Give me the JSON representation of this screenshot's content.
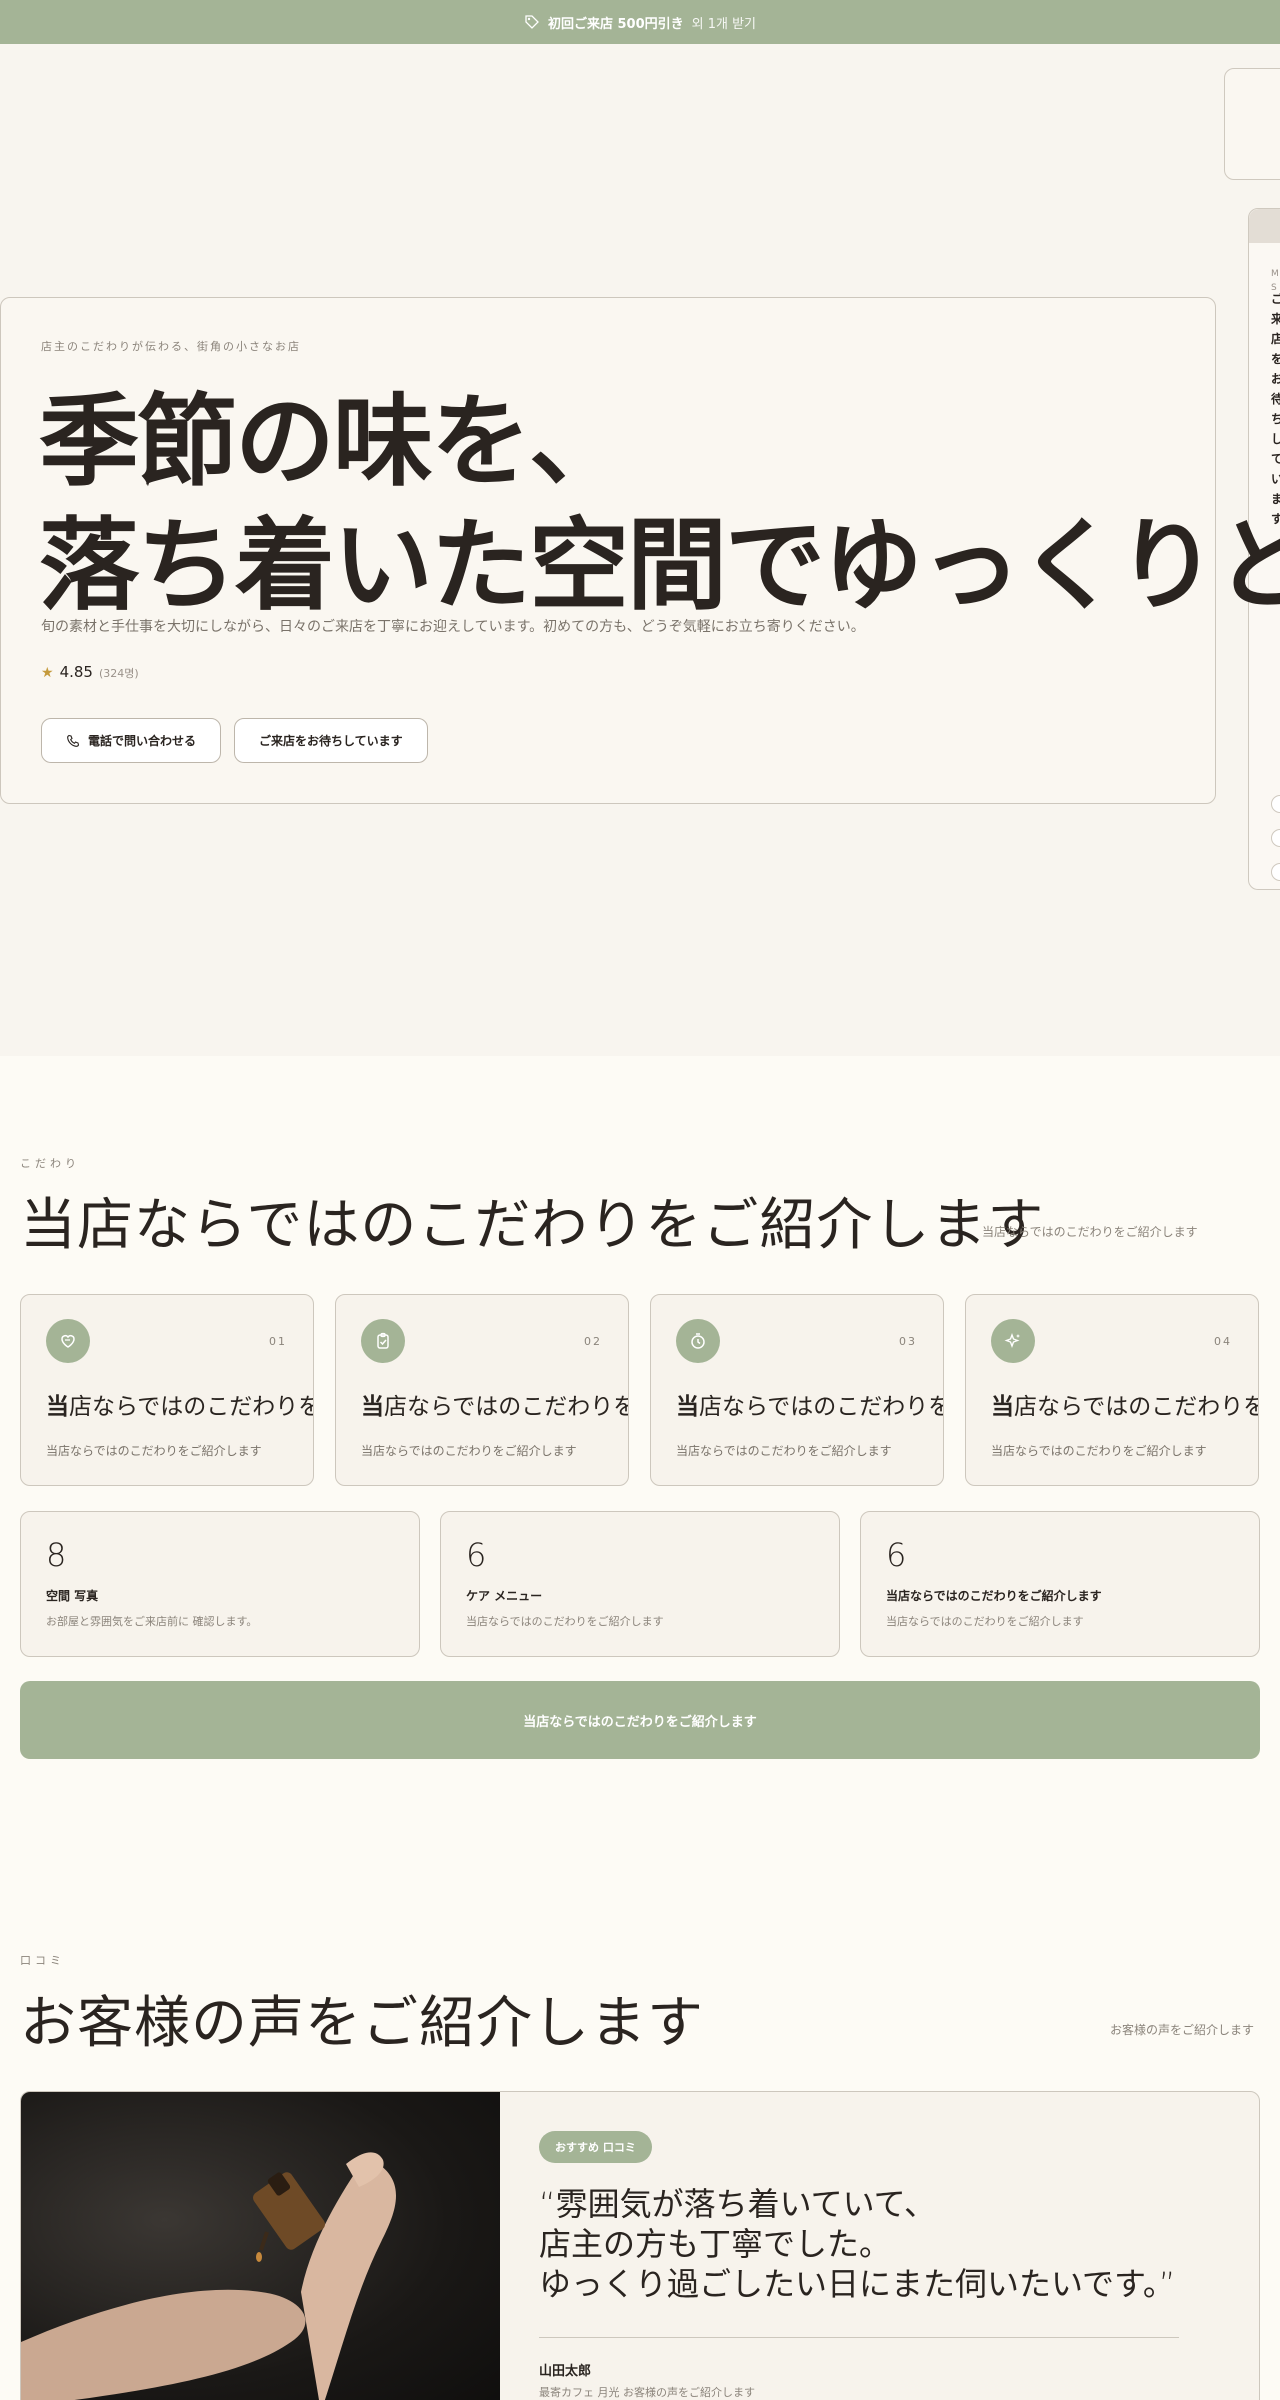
{
  "promo": {
    "strong": "初回ご来店 500円引き",
    "sub": "외 1개 받기",
    "icon": "tag-icon"
  },
  "side_panel": {
    "mini": "M S",
    "vertical_text": "ご来店をお待ちしています",
    "icon": "phone-icon"
  },
  "hero": {
    "kicker": "店主のこだわりが伝わる、街角の小さなお店",
    "title_line1": "季節の味を、",
    "title_line2": "落ち着いた空間でゆっくりと",
    "lead": "旬の素材と手仕事を大切にしながら、日々のご来店を丁寧にお迎えしています。初めての方も、どうぞ気軽にお立ち寄りください。",
    "rating": "4.85",
    "rating_count": "(324명)",
    "btn_call": "電話で問い合わせる",
    "btn_visit": "ご来店をお待ちしています"
  },
  "features": {
    "kicker": "こだわり",
    "title_first": "当",
    "title_rest": "店ならではのこだわりをご紹介します",
    "sub": "当店ならではのこだわりをご紹介します",
    "cards": [
      {
        "num": "01",
        "icon": "heart-hand-icon",
        "title_first": "当",
        "title_rest": "店ならではのこだわりをご紹介します",
        "desc": "当店ならではのこだわりをご紹介します"
      },
      {
        "num": "02",
        "icon": "clipboard-check-icon",
        "title_first": "当",
        "title_rest": "店ならではのこだわりをご紹介します",
        "desc": "当店ならではのこだわりをご紹介します"
      },
      {
        "num": "03",
        "icon": "timer-icon",
        "title_first": "当",
        "title_rest": "店ならではのこだわりをご紹介します",
        "desc": "当店ならではのこだわりをご紹介します"
      },
      {
        "num": "04",
        "icon": "sparkles-icon",
        "title_first": "当",
        "title_rest": "店ならではのこだわりをご紹介します",
        "desc": "当店ならではのこだわりをご紹介します"
      }
    ],
    "stats": [
      {
        "num": "8",
        "label": "空間 写真",
        "desc": "お部屋と雰囲気をご来店前に 確認します。"
      },
      {
        "num": "6",
        "label": "ケア メニュー",
        "desc": "当店ならではのこだわりをご紹介します"
      },
      {
        "num": "6",
        "label": "当店ならではのこだわりをご紹介します",
        "desc": "当店ならではのこだわりをご紹介します"
      }
    ],
    "cta": "当店ならではのこだわりをご紹介します"
  },
  "reviews": {
    "kicker": "口コミ",
    "title_a": "お客",
    "title_b": "様",
    "title_c": "の",
    "title_d": "声",
    "title_e": "をご紹介します",
    "sub": "お客様の声をご紹介します",
    "badge": "おすすめ 口コミ",
    "quote_line1": "“雰囲気が落ち着いていて、",
    "quote_line2": "店主の方も丁寧でした。",
    "quote_line3": "ゆっくり過ごしたい日にまた伺いたいです。”",
    "name": "山田太郎",
    "meta": "最寄カフェ 月光 お客様の声をご紹介します"
  },
  "colors": {
    "accent": "#a4b496",
    "background": "#f8f5ef",
    "text": "#2a2420",
    "star": "#c49a3c"
  }
}
